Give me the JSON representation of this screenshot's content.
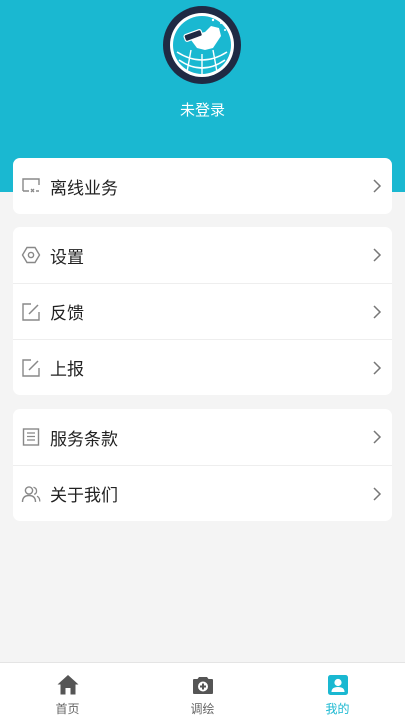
{
  "profile": {
    "username": "未登录"
  },
  "groups": [
    [
      {
        "icon": "offline-icon",
        "label": "离线业务"
      }
    ],
    [
      {
        "icon": "settings-hex-icon",
        "label": "设置"
      },
      {
        "icon": "edit-icon",
        "label": "反馈"
      },
      {
        "icon": "edit-icon",
        "label": "上报"
      }
    ],
    [
      {
        "icon": "document-icon",
        "label": "服务条款"
      },
      {
        "icon": "users-icon",
        "label": "关于我们"
      }
    ]
  ],
  "tabbar": {
    "items": [
      {
        "icon": "home-icon",
        "label": "首页"
      },
      {
        "icon": "camera-icon",
        "label": "调绘"
      },
      {
        "icon": "profile-icon",
        "label": "我的"
      }
    ],
    "active_index": 2
  },
  "colors": {
    "accent": "#1ab8d1",
    "background": "#f4f4f4",
    "logo_dark": "#1f2a44"
  }
}
